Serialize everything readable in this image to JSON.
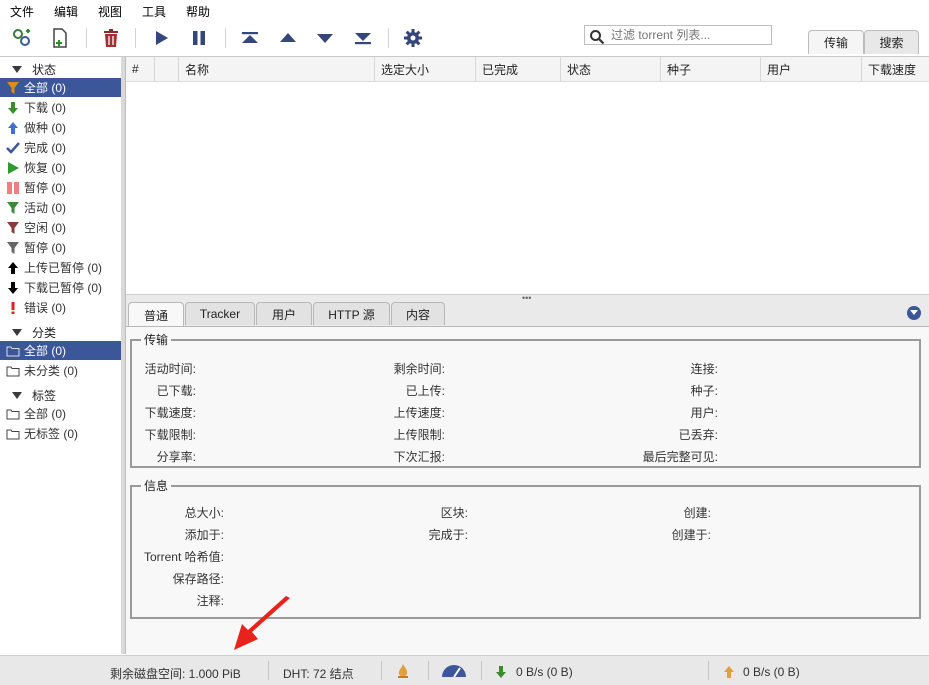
{
  "menu": [
    "文件",
    "编辑",
    "视图",
    "工具",
    "帮助"
  ],
  "search": {
    "placeholder": "过滤 torrent 列表..."
  },
  "right_tabs": {
    "transfer": "传输",
    "search": "搜索"
  },
  "sidebar": {
    "status_header": "状态",
    "status_items": [
      {
        "label": "全部 (0)",
        "icon": "filter-icon",
        "color": "#e08a1e"
      },
      {
        "label": "下载 (0)",
        "icon": "down-arrow-icon",
        "color": "#3c8a2e"
      },
      {
        "label": "做种 (0)",
        "icon": "up-arrow-icon",
        "color": "#3f6fd1"
      },
      {
        "label": "完成 (0)",
        "icon": "checkmark-icon",
        "color": "#3b5699"
      },
      {
        "label": "恢复 (0)",
        "icon": "play-icon",
        "color": "#2e9a2e"
      },
      {
        "label": "暂停 (0)",
        "icon": "pause-icon",
        "color": "#f08080"
      },
      {
        "label": "活动 (0)",
        "icon": "filter-icon",
        "color": "#3a8a3a"
      },
      {
        "label": "空闲 (0)",
        "icon": "filter-icon",
        "color": "#8a3a3a"
      },
      {
        "label": "暂停 (0)",
        "icon": "filter-icon",
        "color": "#666666"
      },
      {
        "label": "上传已暂停 (0)",
        "icon": "up-arrow-icon",
        "color": "#000000"
      },
      {
        "label": "下载已暂停 (0)",
        "icon": "down-arrow-icon",
        "color": "#000000"
      },
      {
        "label": "错误 (0)",
        "icon": "exclamation-icon",
        "color": "#e02020"
      }
    ],
    "category_header": "分类",
    "category_items": [
      {
        "label": "全部 (0)",
        "icon": "folder-icon"
      },
      {
        "label": "未分类 (0)",
        "icon": "folder-icon"
      }
    ],
    "tags_header": "标签",
    "tag_items": [
      {
        "label": "全部 (0)",
        "icon": "folder-icon"
      },
      {
        "label": "无标签 (0)",
        "icon": "folder-icon"
      }
    ]
  },
  "table": {
    "columns": [
      "#",
      "",
      "名称",
      "选定大小",
      "已完成",
      "状态",
      "种子",
      "用户",
      "下载速度"
    ]
  },
  "props": {
    "tabs": [
      "普通",
      "Tracker",
      "用户",
      "HTTP 源",
      "内容"
    ],
    "transfer_legend": "传输",
    "transfer": {
      "col1": [
        "活动时间:",
        "已下载:",
        "下载速度:",
        "下载限制:",
        "分享率:"
      ],
      "col2": [
        "剩余时间:",
        "已上传:",
        "上传速度:",
        "上传限制:",
        "下次汇报:"
      ],
      "col3": [
        "连接:",
        "种子:",
        "用户:",
        "已丢弃:",
        "最后完整可见:"
      ]
    },
    "info_legend": "信息",
    "info": {
      "col1": [
        "总大小:",
        "添加于:",
        "Torrent 哈希值:",
        "保存路径:",
        "注释:"
      ],
      "col2": [
        "区块:",
        "完成于:"
      ],
      "col3": [
        "创建:",
        "创建于:"
      ]
    }
  },
  "status": {
    "disk_free": "剩余磁盘空间: 1.000 PiB",
    "dht": "DHT: 72 结点",
    "download": "0 B/s (0 B)",
    "upload": "0 B/s (0 B)"
  },
  "colors": {
    "accent": "#3b5699",
    "annotation_arrow": "#e8231b"
  }
}
